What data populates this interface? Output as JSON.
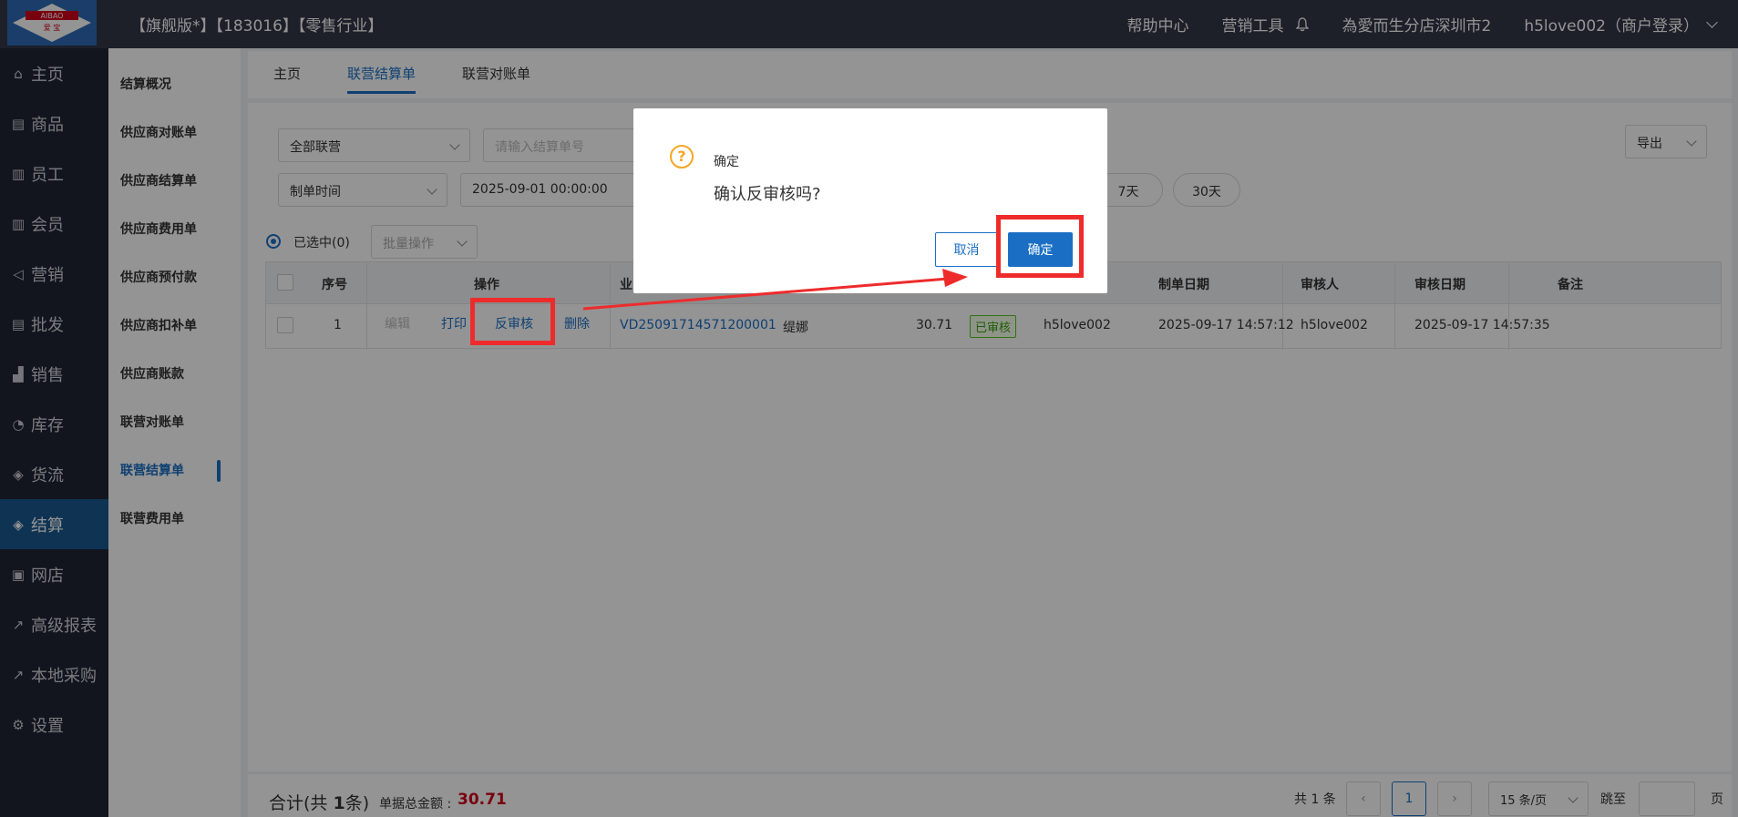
{
  "header": {
    "logo_text": "AIBAO 爱宝",
    "title": "【旗舰版*】【183016】【零售行业】",
    "help": "帮助中心",
    "marketing_tools": "营销工具",
    "store": "為愛而生分店深圳市2",
    "user": "h5love002（商户登录）"
  },
  "sidebar": {
    "items": [
      {
        "label": "主页",
        "icon": "home-icon"
      },
      {
        "label": "商品",
        "icon": "goods-icon"
      },
      {
        "label": "员工",
        "icon": "staff-icon"
      },
      {
        "label": "会员",
        "icon": "member-icon"
      },
      {
        "label": "营销",
        "icon": "megaphone-icon"
      },
      {
        "label": "批发",
        "icon": "wholesale-icon"
      },
      {
        "label": "销售",
        "icon": "sales-chart-icon"
      },
      {
        "label": "库存",
        "icon": "inventory-pie-icon"
      },
      {
        "label": "货流",
        "icon": "cube-icon"
      },
      {
        "label": "结算",
        "icon": "settlement-icon"
      },
      {
        "label": "网店",
        "icon": "gift-icon"
      },
      {
        "label": "高级报表",
        "icon": "report-line-icon"
      },
      {
        "label": "本地采购",
        "icon": "purchase-line-icon"
      },
      {
        "label": "设置",
        "icon": "gear-icon"
      }
    ],
    "active": "结算"
  },
  "subnav": {
    "items": [
      "结算概况",
      "供应商对账单",
      "供应商结算单",
      "供应商费用单",
      "供应商预付款",
      "供应商扣补单",
      "供应商账款",
      "联营对账单",
      "联营结算单",
      "联营费用单"
    ],
    "active": "联营结算单"
  },
  "tabs": [
    "主页",
    "联营结算单",
    "联营对账单"
  ],
  "filters": {
    "type_select": "全部联营",
    "settle_no_placeholder": "请输入结算单号",
    "date_type_select": "制单时间",
    "start_date": "2025-09-01 00:00:00",
    "quick_7": "7天",
    "quick_30": "30天",
    "export": "导出"
  },
  "selection": {
    "selected_label": "已选中(0)",
    "batch_label": "批量操作"
  },
  "table": {
    "headers": {
      "seq": "序号",
      "ops": "操作",
      "biz": "业",
      "created_date": "制单日期",
      "auditor": "审核人",
      "audit_date": "审核日期",
      "remark": "备注"
    },
    "row": {
      "seq": "1",
      "op_edit": "编辑",
      "op_print": "打印",
      "op_unaudit": "反审核",
      "op_delete": "删除",
      "doc_no": "VD25091714571200001",
      "partner": "缇娜",
      "amount": "30.71",
      "status": "已审核",
      "creator": "h5love002",
      "created_date": "2025-09-17 14:57:12",
      "auditor": "h5love002",
      "audit_date": "2025-09-17 14:57:35"
    }
  },
  "footer": {
    "total_prefix": "合计(共 ",
    "total_count": "1",
    "total_suffix": "条)",
    "amount_label": "单据总金额 :",
    "amount_value": "30.71",
    "pager_total": "共 1 条",
    "current_page": "1",
    "page_size": "15 条/页",
    "jump_label": "跳至",
    "page_label": "页"
  },
  "dialog": {
    "title": "确定",
    "message": "确认反审核吗?",
    "cancel": "取消",
    "ok": "确定"
  },
  "colors": {
    "primary": "#1a6fc4",
    "header_bg": "#323647",
    "sidebar_bg": "#1f2533",
    "sidebar_active": "#19598f",
    "highlight": "#ee2b2b",
    "warning": "#f5a623",
    "amount_red": "#d0021b"
  }
}
